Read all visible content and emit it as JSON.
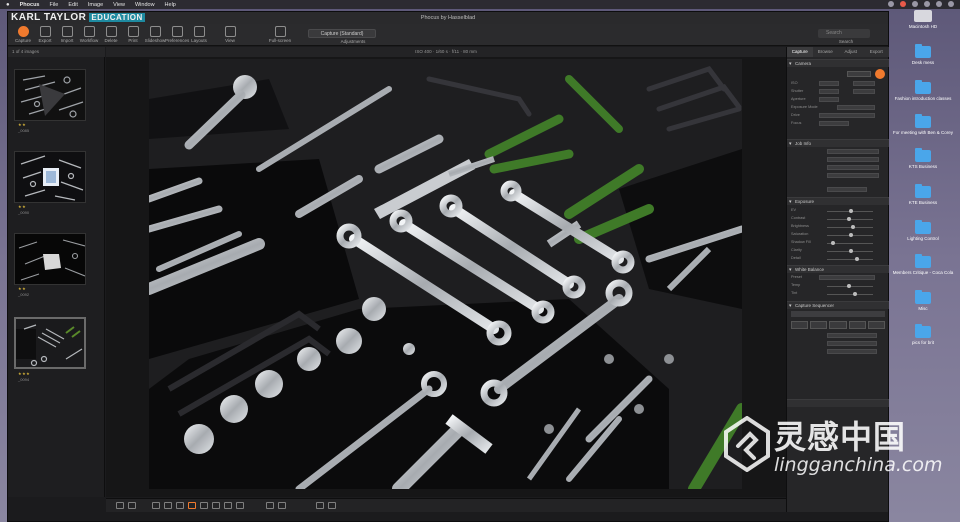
{
  "menubar": {
    "app_name": "Phocus",
    "items": [
      "File",
      "Edit",
      "Image",
      "View",
      "Window",
      "Help"
    ]
  },
  "window": {
    "title": "Phocus by Hasselblad",
    "brand": "KARL TAYLOR",
    "brand_tag": "EDUCATION"
  },
  "toolbar": {
    "left_buttons": [
      "Capture",
      "Export",
      "Import",
      "Workflow",
      "Delete",
      "Print",
      "Slideshow",
      "Preferences",
      "Layouts"
    ],
    "group_labels": [
      "View",
      "Full-screen",
      "Adjustments"
    ],
    "style_select": "Capture (Standard)",
    "search_label": "Search",
    "search_placeholder": "Search"
  },
  "filmstrip": {
    "header": "1 of 4 images",
    "thumbs": [
      {
        "label": "_0085",
        "stars": "★★"
      },
      {
        "label": "_0090",
        "stars": "★★"
      },
      {
        "label": "_0092",
        "stars": "★★"
      },
      {
        "label": "_0094",
        "stars": "★★★"
      }
    ]
  },
  "viewer": {
    "header": "ISO 400 · 1/60 s · f/11 · 80 mm"
  },
  "tools": {
    "tabs": [
      "Capture",
      "Browse",
      "Adjust",
      "Export"
    ],
    "sections": [
      "Camera",
      "Job Info",
      "Exposure",
      "White Balance",
      "Capture Sequencer"
    ],
    "camera_rows": [
      "ISO",
      "Shutter",
      "Aperture",
      "Exposure Mode",
      "Drive",
      "Focus"
    ],
    "exposure_rows": [
      "EV",
      "Contrast",
      "Brightness",
      "Saturation",
      "Shadow Fill",
      "Clarity",
      "Detail"
    ],
    "wb_rows": [
      "Preset",
      "Temp",
      "Tint"
    ],
    "active_tab": "Capture"
  },
  "desktop": {
    "icons": [
      {
        "label": "Macintosh HD",
        "type": "drive"
      },
      {
        "label": "Desk mess",
        "type": "folder"
      },
      {
        "label": "Fashion introduction classes",
        "type": "folder"
      },
      {
        "label": "For meeting with Ben & Corey",
        "type": "folder"
      },
      {
        "label": "KTS Business",
        "type": "folder"
      },
      {
        "label": "KTE Business",
        "type": "folder"
      },
      {
        "label": "Lighting Control",
        "type": "folder"
      },
      {
        "label": "Members Critique - Coca Cola",
        "type": "folder"
      },
      {
        "label": "Misc",
        "type": "folder"
      },
      {
        "label": "pics for brit",
        "type": "folder"
      }
    ]
  },
  "watermark": {
    "chinese": "灵感中国",
    "url": "lingganchina.com"
  },
  "colors": {
    "accent": "#f07a2e",
    "folder": "#4aa6ea",
    "panel_bg": "#262628",
    "viewer_bg": "#161617"
  }
}
